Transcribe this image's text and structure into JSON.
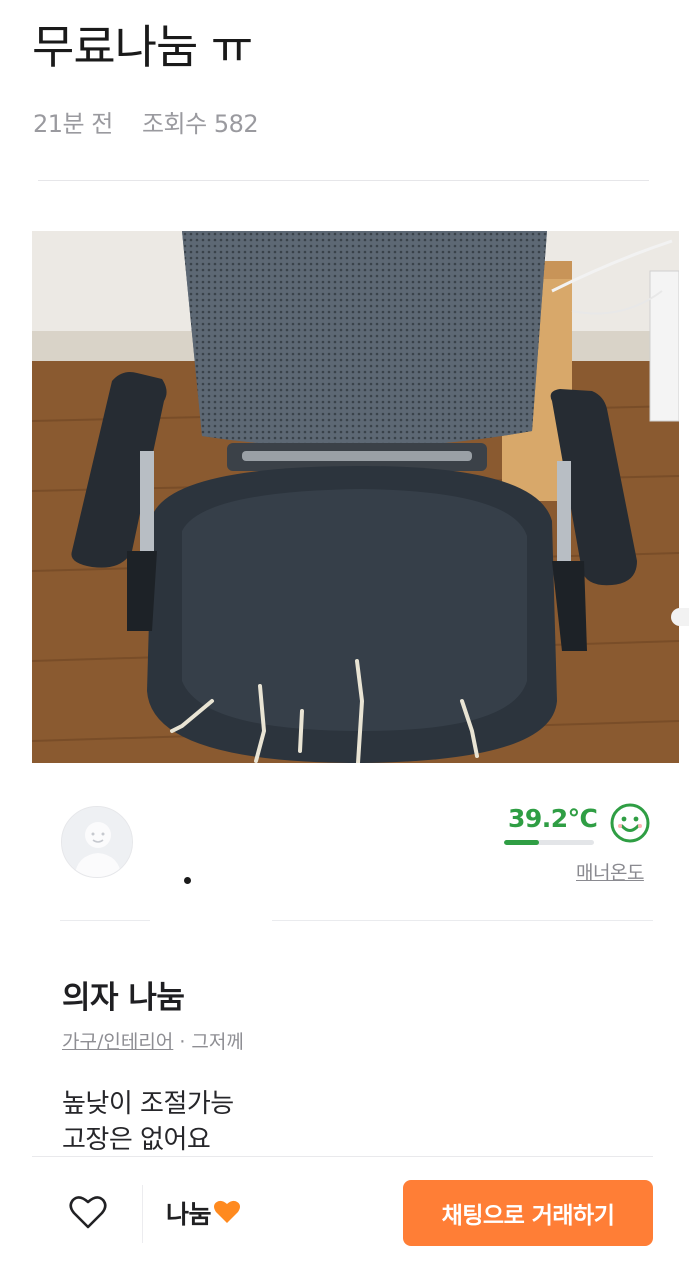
{
  "header": {
    "title": "무료나눔 ㅠ",
    "time_ago": "21분 전",
    "views": "조회수 582"
  },
  "photo": {
    "subject": "chair"
  },
  "seller": {
    "manner_temperature": "39.2℃",
    "manner_label": "매너온도",
    "manner_level": 0.39
  },
  "post": {
    "title": "의자 나눔",
    "category": "가구/인테리어",
    "meta_separator": " · ",
    "posted": "그저께",
    "body_line1": "높낮이 조절가능",
    "body_line2": "고장은 없어요"
  },
  "bottom_bar": {
    "price": "나눔",
    "chat_button": "채팅으로 거래하기"
  },
  "colors": {
    "accent": "#ff7e36",
    "manner_green": "#2f9e44"
  }
}
